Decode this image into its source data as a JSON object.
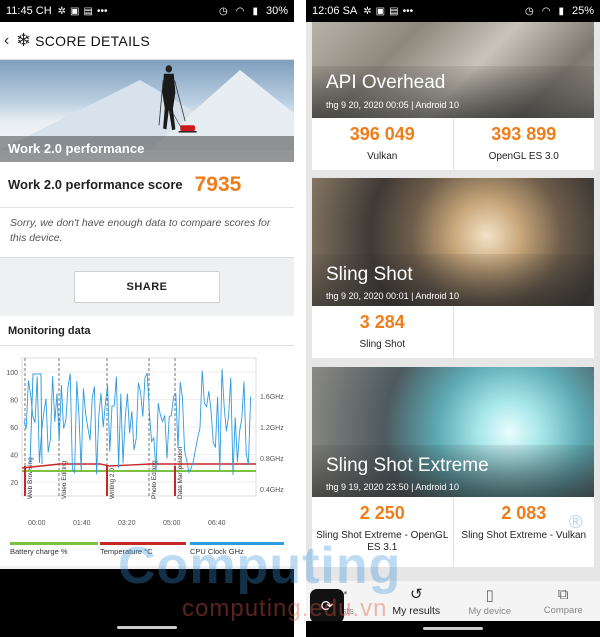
{
  "left": {
    "status": {
      "time": "11:45 CH",
      "battery": "30%"
    },
    "header": {
      "back": "‹",
      "snowflake": "❄",
      "title": "SCORE DETAILS"
    },
    "hero": {
      "banner": "Work 2.0 performance"
    },
    "score": {
      "label": "Work 2.0 performance score",
      "value": "7935"
    },
    "sorry": "Sorry, we don't have enough data to compare scores for this device.",
    "share_label": "SHARE",
    "monitoring": {
      "title": "Monitoring data",
      "y_ticks": [
        "100",
        "80",
        "60",
        "40",
        "20"
      ],
      "freq_ticks": [
        "1.6GHz",
        "1.2GHz",
        "0.8GHz",
        "0.4GHz"
      ],
      "x_ticks": [
        "00:00",
        "01:40",
        "03:20",
        "05:00",
        "06:40"
      ],
      "phases": [
        "Web Browsing",
        "Video Editing",
        "Writing 2.0",
        "Photo Editing",
        "Data Manipulation"
      ],
      "legend": [
        "Battery charge %",
        "Temperature °C",
        "CPU Clock GHz"
      ],
      "colors": {
        "battery": "#7cc242",
        "temperature": "#c62828",
        "cpu": "#2f9be0"
      }
    }
  },
  "right": {
    "status": {
      "time": "12:06 SA",
      "battery": "25%"
    },
    "benchmarks": [
      {
        "name": "API Overhead",
        "meta": "thg 9 20, 2020 00:05 | Android 10",
        "scores": [
          {
            "value": "396 049",
            "label": "Vulkan"
          },
          {
            "value": "393 899",
            "label": "OpenGL ES 3.0"
          }
        ]
      },
      {
        "name": "Sling Shot",
        "meta": "thg 9 20, 2020 00:01 | Android 10",
        "scores": [
          {
            "value": "3 284",
            "label": "Sling Shot"
          },
          {
            "value": "",
            "label": ""
          }
        ]
      },
      {
        "name": "Sling Shot Extreme",
        "meta": "thg 9 19, 2020 23:50 | Android 10",
        "scores": [
          {
            "value": "2 250",
            "label": "Sling Shot Extreme - OpenGL ES 3.1"
          },
          {
            "value": "2 083",
            "label": "Sling Shot Extreme - Vulkan"
          }
        ]
      }
    ],
    "tabs": [
      {
        "label": "Tests",
        "icon": "tests-icon"
      },
      {
        "label": "My results",
        "icon": "history-icon"
      },
      {
        "label": "My device",
        "icon": "device-icon"
      },
      {
        "label": "Compare",
        "icon": "compare-icon"
      }
    ]
  },
  "watermark": {
    "main": "Computing",
    "sub": "computing.edu.vn"
  }
}
